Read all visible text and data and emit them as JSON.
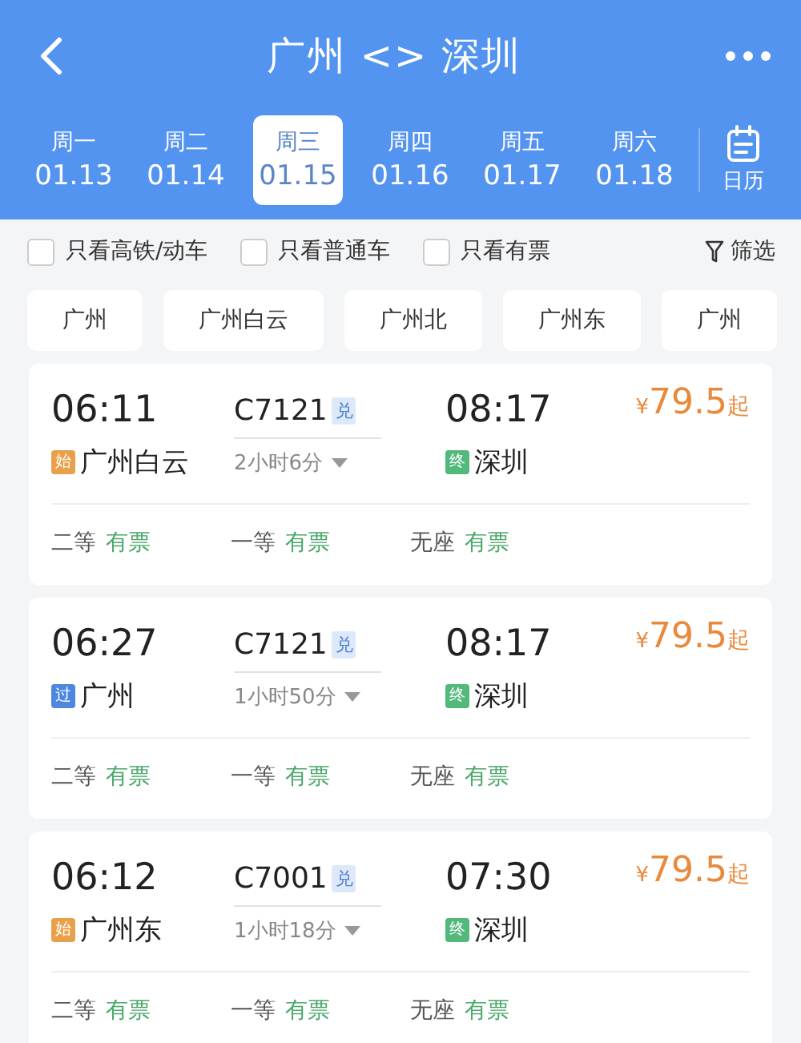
{
  "header": {
    "title": "广州 <> 深圳"
  },
  "dates": [
    {
      "weekday": "周一",
      "date": "01.13",
      "selected": false
    },
    {
      "weekday": "周二",
      "date": "01.14",
      "selected": false
    },
    {
      "weekday": "周三",
      "date": "01.15",
      "selected": true
    },
    {
      "weekday": "周四",
      "date": "01.16",
      "selected": false
    },
    {
      "weekday": "周五",
      "date": "01.17",
      "selected": false
    },
    {
      "weekday": "周六",
      "date": "01.18",
      "selected": false
    }
  ],
  "calendar_label": "日历",
  "filters": [
    {
      "label": "只看高铁/动车",
      "checked": false
    },
    {
      "label": "只看普通车",
      "checked": false
    },
    {
      "label": "只看有票",
      "checked": false
    }
  ],
  "filter_button": "筛选",
  "stations": [
    "广州",
    "广州白云",
    "广州北",
    "广州东",
    "广州"
  ],
  "trains": [
    {
      "depart_time": "06:11",
      "from_badge": {
        "kind": "start",
        "text": "始"
      },
      "from": "广州白云",
      "number": "C7121",
      "tag": "兑",
      "duration": "2小时6分",
      "arrive_time": "08:17",
      "to_badge": {
        "kind": "end",
        "text": "终"
      },
      "to": "深圳",
      "currency": "¥",
      "price": "79.5",
      "price_suffix": "起",
      "seats": [
        {
          "class": "二等",
          "status": "有票"
        },
        {
          "class": "一等",
          "status": "有票"
        },
        {
          "class": "无座",
          "status": "有票"
        }
      ]
    },
    {
      "depart_time": "06:27",
      "from_badge": {
        "kind": "pass",
        "text": "过"
      },
      "from": "广州",
      "number": "C7121",
      "tag": "兑",
      "duration": "1小时50分",
      "arrive_time": "08:17",
      "to_badge": {
        "kind": "end",
        "text": "终"
      },
      "to": "深圳",
      "currency": "¥",
      "price": "79.5",
      "price_suffix": "起",
      "seats": [
        {
          "class": "二等",
          "status": "有票"
        },
        {
          "class": "一等",
          "status": "有票"
        },
        {
          "class": "无座",
          "status": "有票"
        }
      ]
    },
    {
      "depart_time": "06:12",
      "from_badge": {
        "kind": "start",
        "text": "始"
      },
      "from": "广州东",
      "number": "C7001",
      "tag": "兑",
      "duration": "1小时18分",
      "arrive_time": "07:30",
      "to_badge": {
        "kind": "end",
        "text": "终"
      },
      "to": "深圳",
      "currency": "¥",
      "price": "79.5",
      "price_suffix": "起",
      "seats": [
        {
          "class": "二等",
          "status": "有票"
        },
        {
          "class": "一等",
          "status": "有票"
        },
        {
          "class": "无座",
          "status": "有票"
        }
      ]
    }
  ]
}
